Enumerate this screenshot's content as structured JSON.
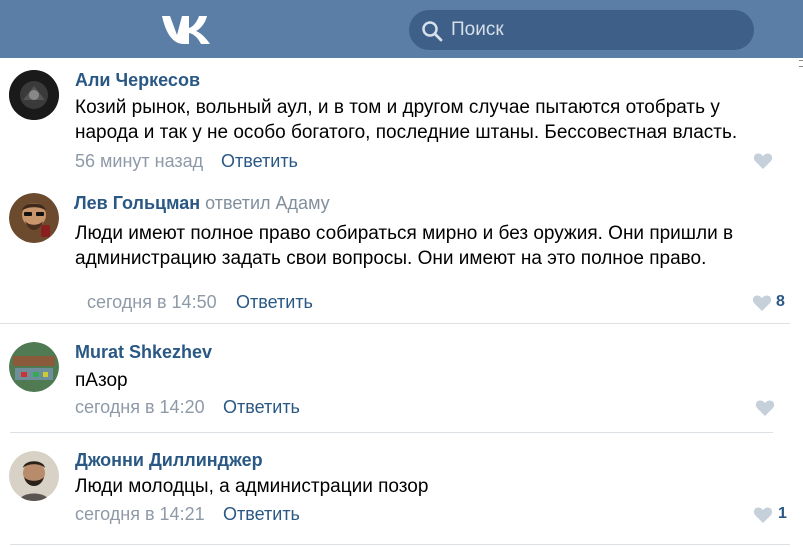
{
  "header": {
    "logo_icon": "vk-logo-icon",
    "search": {
      "placeholder": "Поиск",
      "icon": "search-icon"
    }
  },
  "comments": [
    {
      "author": "Али Черкесов",
      "replied": "",
      "text_lines": [
        "Козий рынок, вольный аул, и в том и другом случае пытаются отобрать у",
        "народа и так у не особо богатого, последние штаны. Бессовестная власть."
      ],
      "time": "56 минут назад",
      "reply_label": "Ответить",
      "likes": ""
    },
    {
      "author": "Лев Гольцман",
      "replied": "ответил Адаму",
      "text_lines": [
        "Люди имеют полное право собираться мирно и без оружия. Они пришли в",
        "администрацию задать свои вопросы. Они имеют на это полное право."
      ],
      "time": "сегодня в 14:50",
      "reply_label": "Ответить",
      "likes": "8"
    },
    {
      "author": "Murat Shkezhev",
      "replied": "",
      "text_lines": [
        "пАзор"
      ],
      "time": "сегодня в 14:20",
      "reply_label": "Ответить",
      "likes": ""
    },
    {
      "author": "Джонни Диллинджер",
      "replied": "",
      "text_lines": [
        "Люди молодцы, а администрации позор"
      ],
      "time": "сегодня в 14:21",
      "reply_label": "Ответить",
      "likes": "1"
    }
  ],
  "colors": {
    "header_bg": "#5b7ea6",
    "link": "#2a5885",
    "meta": "#8e9aa8",
    "like_heart": "#c5d0db"
  }
}
